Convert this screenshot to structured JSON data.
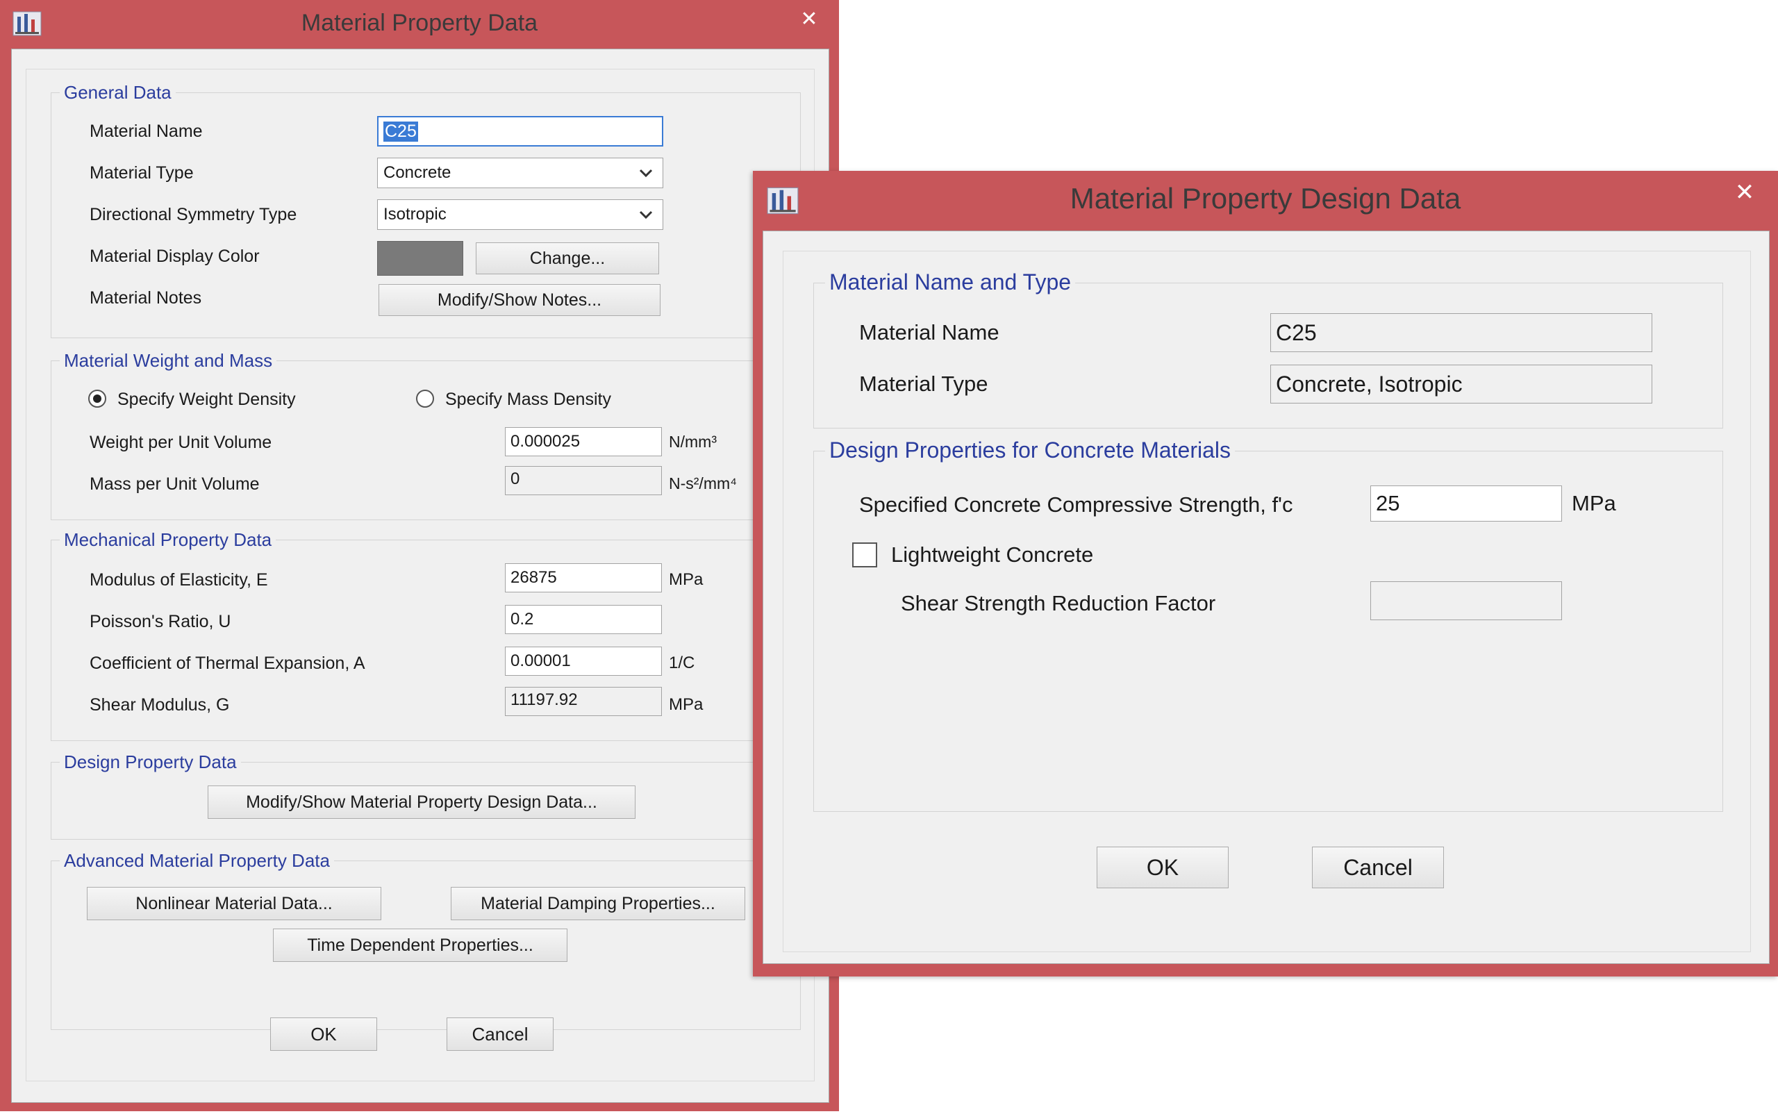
{
  "main_dialog": {
    "title": "Material Property Data",
    "close_glyph": "✕",
    "icon": "app-structure-icon",
    "general_data": {
      "title": "General Data",
      "material_name_label": "Material Name",
      "material_name_value": "C25",
      "material_type_label": "Material Type",
      "material_type_value": "Concrete",
      "directional_symmetry_label": "Directional Symmetry Type",
      "directional_symmetry_value": "Isotropic",
      "display_color_label": "Material Display Color",
      "display_color_value": "#7a7a7a",
      "change_button": "Change...",
      "notes_label": "Material Notes",
      "notes_button": "Modify/Show Notes..."
    },
    "weight_mass": {
      "title": "Material Weight and Mass",
      "radio_weight": "Specify Weight Density",
      "radio_mass": "Specify Mass Density",
      "weight_label": "Weight per Unit Volume",
      "weight_value": "0.000025",
      "weight_unit": "N/mm³",
      "mass_label": "Mass per Unit Volume",
      "mass_value": "0",
      "mass_unit": "N-s²/mm⁴"
    },
    "mechanical": {
      "title": "Mechanical Property Data",
      "modulus_label": "Modulus of Elasticity,  E",
      "modulus_value": "26875",
      "modulus_unit": "MPa",
      "poisson_label": "Poisson's Ratio,  U",
      "poisson_value": "0.2",
      "thermal_label": "Coefficient of Thermal Expansion,  A",
      "thermal_value": "0.00001",
      "thermal_unit": "1/C",
      "shear_label": "Shear Modulus,  G",
      "shear_value": "11197.92",
      "shear_unit": "MPa"
    },
    "design": {
      "title": "Design Property Data",
      "button": "Modify/Show Material Property Design Data..."
    },
    "advanced": {
      "title": "Advanced Material Property Data",
      "nonlinear_button": "Nonlinear Material Data...",
      "damping_button": "Material Damping Properties...",
      "time_button": "Time Dependent Properties..."
    },
    "ok": "OK",
    "cancel": "Cancel"
  },
  "design_dialog": {
    "title": "Material Property Design Data",
    "close_glyph": "✕",
    "icon": "app-structure-icon",
    "name_type": {
      "title": "Material Name and Type",
      "name_label": "Material Name",
      "name_value": "C25",
      "type_label": "Material Type",
      "type_value": "Concrete, Isotropic"
    },
    "concrete": {
      "title": "Design Properties for Concrete Materials",
      "fc_label": "Specified Concrete Compressive Strength, f'c",
      "fc_value": "25",
      "fc_unit": "MPa",
      "lightweight_label": "Lightweight Concrete",
      "lightweight_checked": false,
      "shear_reduction_label": "Shear Strength Reduction Factor",
      "shear_reduction_value": ""
    },
    "ok": "OK",
    "cancel": "Cancel"
  },
  "colors": {
    "window_frame": "#c7565a",
    "group_title": "#2b3d9e",
    "dialog_bg": "#f0f0f0"
  }
}
